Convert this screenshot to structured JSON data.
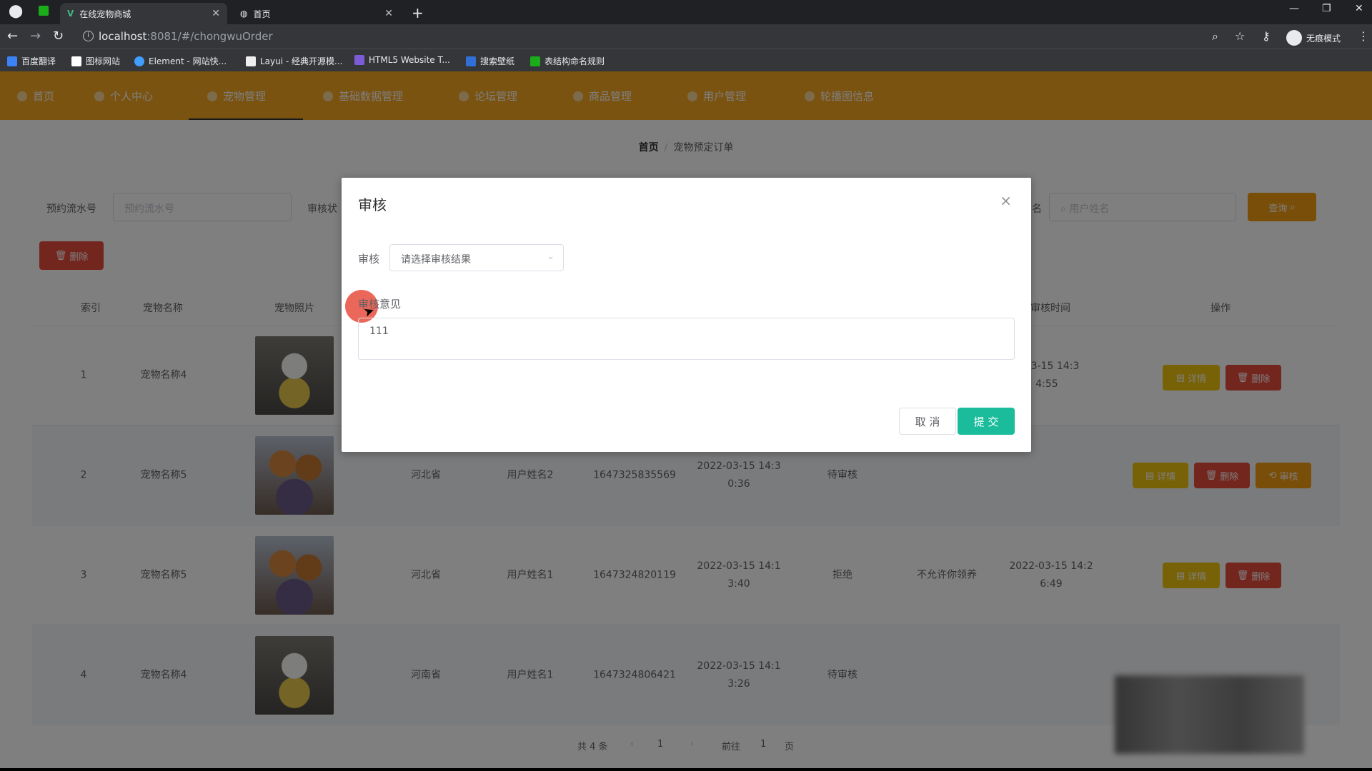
{
  "browser": {
    "tabs": [
      {
        "title": "在线宠物商城",
        "active": true
      },
      {
        "title": "首页",
        "active": false
      }
    ],
    "url_host": "localhost",
    "url_rest": ":8081/#/chongwuOrder",
    "incognito_label": "无痕模式",
    "bookmarks": [
      "百度翻译",
      "图标网站",
      "Element - 网站快...",
      "Layui - 经典开源模...",
      "HTML5 Website T...",
      "搜索壁纸",
      "表结构命名规则"
    ]
  },
  "colors": {
    "nav_bg": "#f5a623",
    "submit": "#1abc9c",
    "danger": "#e74c3c",
    "warning": "#f1c40f",
    "accent": "#f39c12"
  },
  "nav": {
    "items": [
      "首页",
      "个人中心",
      "宠物管理",
      "基础数据管理",
      "论坛管理",
      "商品管理",
      "用户管理",
      "轮播图信息"
    ],
    "active_index": 2
  },
  "breadcrumb": {
    "home": "首页",
    "separator": "/",
    "current": "宠物预定订单"
  },
  "search": {
    "order_no_label": "预约流水号",
    "order_no_placeholder": "预约流水号",
    "status_label": "审核状",
    "name_label_tail": "名",
    "username_placeholder": "用户姓名",
    "search_button": "查询",
    "delete_button": "删除"
  },
  "table": {
    "headers": [
      "索引",
      "宠物名称",
      "宠物照片",
      "审核时间",
      "操作"
    ],
    "rows": [
      {
        "index": "1",
        "pet_name": "宠物名称4",
        "photo": "white",
        "province": "",
        "user": "",
        "serial": "",
        "time_a": "",
        "time_b": "",
        "status": "",
        "opinion": "",
        "review_a": "2-03-15 14:3",
        "review_b": "4:55",
        "actions": [
          "详情",
          "删除"
        ]
      },
      {
        "index": "2",
        "pet_name": "宠物名称5",
        "photo": "orange",
        "province": "河北省",
        "user": "用户姓名2",
        "serial": "1647325835569",
        "time_a": "2022-03-15 14:3",
        "time_b": "0:36",
        "status": "待审核",
        "opinion": "",
        "review_a": "",
        "review_b": "",
        "actions": [
          "详情",
          "删除",
          "审核"
        ]
      },
      {
        "index": "3",
        "pet_name": "宠物名称5",
        "photo": "orange",
        "province": "河北省",
        "user": "用户姓名1",
        "serial": "1647324820119",
        "time_a": "2022-03-15 14:1",
        "time_b": "3:40",
        "status": "拒绝",
        "opinion": "不允许你领养",
        "review_a": "2022-03-15 14:2",
        "review_b": "6:49",
        "actions": [
          "详情",
          "删除"
        ]
      },
      {
        "index": "4",
        "pet_name": "宠物名称4",
        "photo": "white",
        "province": "河南省",
        "user": "用户姓名1",
        "serial": "1647324806421",
        "time_a": "2022-03-15 14:1",
        "time_b": "3:26",
        "status": "待审核",
        "opinion": "",
        "review_a": "",
        "review_b": "",
        "actions": []
      }
    ]
  },
  "pagination": {
    "total": "共 4 条",
    "current_page": "1",
    "goto": "前往",
    "page_value": "1",
    "page_suffix": "页"
  },
  "dialog": {
    "title": "审核",
    "review_label": "审核",
    "select_placeholder": "请选择审核结果",
    "opinion_label": "审核意见",
    "opinion_value": "111",
    "cancel": "取 消",
    "submit": "提 交"
  }
}
